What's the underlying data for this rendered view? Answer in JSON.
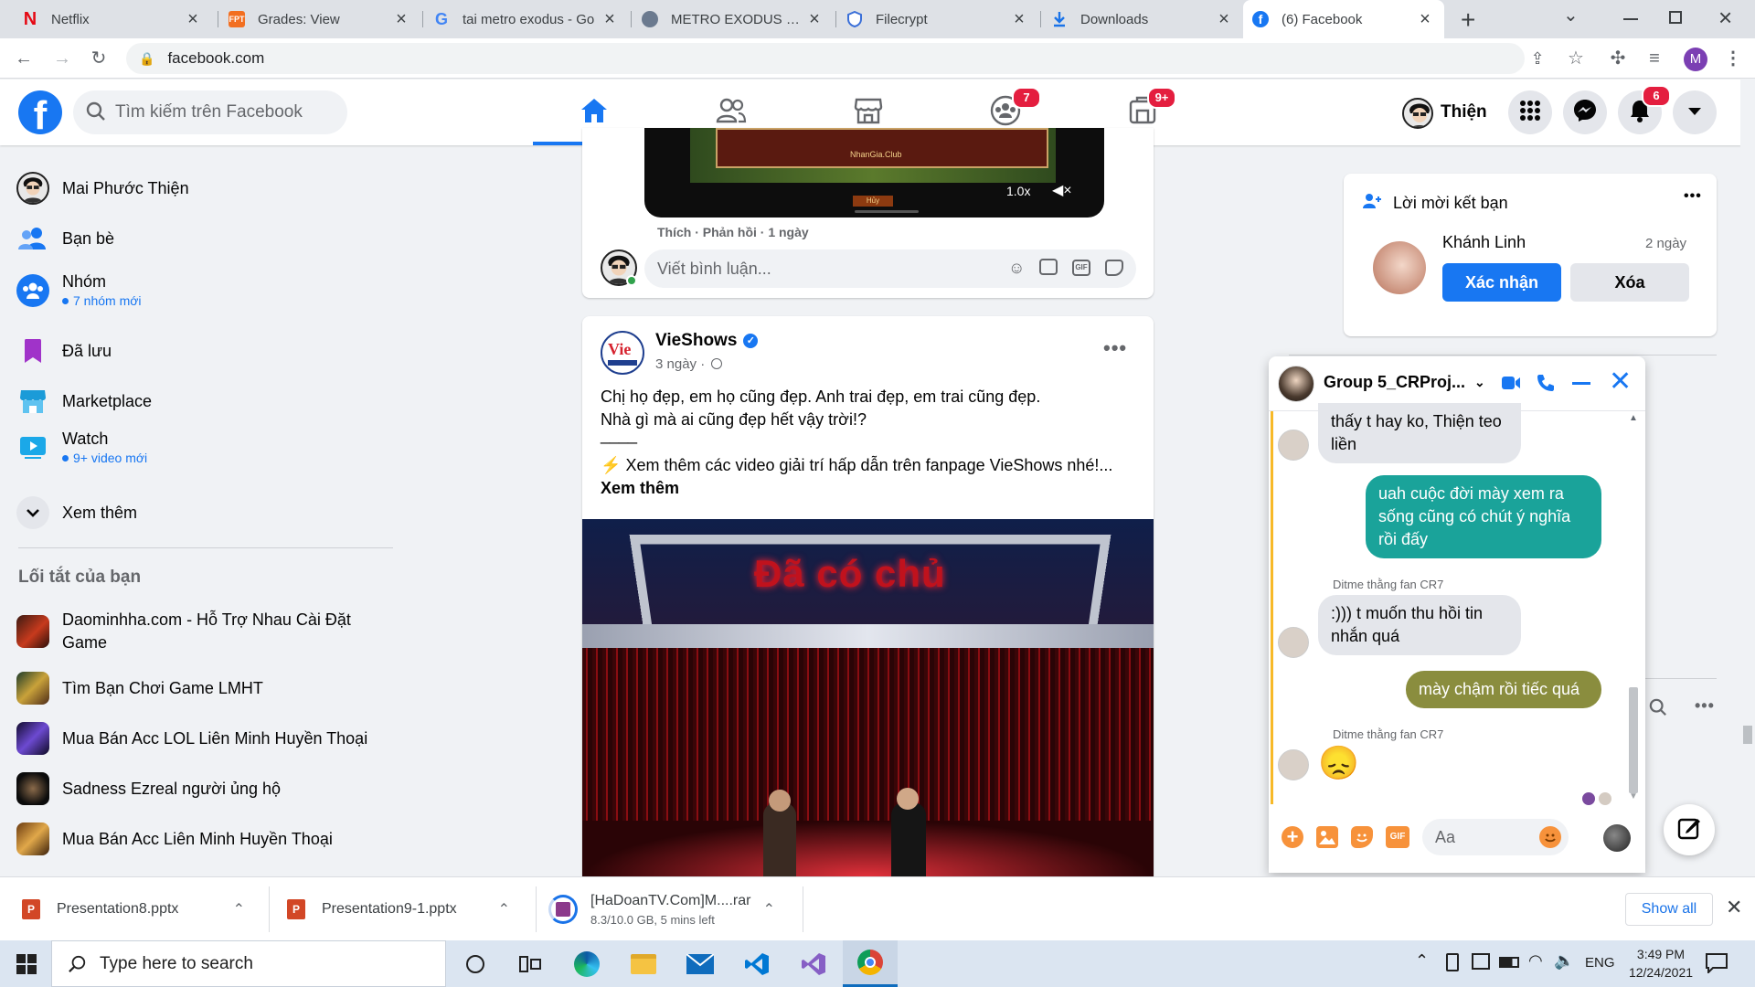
{
  "browser": {
    "tabs": [
      {
        "title": "Netflix",
        "icon": "netflix-icon",
        "color": "#e50914"
      },
      {
        "title": "Grades: View",
        "icon": "fpt-icon",
        "color": "#f26f21"
      },
      {
        "title": "tai metro exodus - Go",
        "icon": "google-icon",
        "color": "#4285f4"
      },
      {
        "title": "METRO EXODUS ENH",
        "icon": "globe-icon",
        "color": "#5f6368"
      },
      {
        "title": "Filecrypt",
        "icon": "shield-icon",
        "color": "#3a6fd8"
      },
      {
        "title": "Downloads",
        "icon": "download-icon",
        "color": "#1a73e8"
      },
      {
        "title": "(6) Facebook",
        "icon": "facebook-icon",
        "color": "#1877f2"
      }
    ],
    "url": "facebook.com",
    "profile_initial": "M"
  },
  "facebook": {
    "search_placeholder": "Tìm kiếm trên Facebook",
    "nav_badges": {
      "groups": "7",
      "gaming": "9+"
    },
    "user_name": "Thiện",
    "notification_count": "6",
    "colors": {
      "brand": "#1877f2",
      "badge": "#e41e3f"
    }
  },
  "sidebar": {
    "items": [
      {
        "label": "Mai Phước Thiện",
        "icon": "avatar"
      },
      {
        "label": "Bạn bè",
        "icon": "friends-icon"
      },
      {
        "label": "Nhóm",
        "sub": "7 nhóm mới",
        "icon": "groups-icon"
      },
      {
        "label": "Đã lưu",
        "icon": "bookmark-icon"
      },
      {
        "label": "Marketplace",
        "icon": "marketplace-icon"
      },
      {
        "label": "Watch",
        "sub": "9+ video mới",
        "icon": "watch-icon"
      },
      {
        "label": "Xem thêm",
        "icon": "chevron-down-icon"
      }
    ],
    "shortcuts_title": "Lối tắt của bạn",
    "shortcuts": [
      "Daominhha.com - Hỗ Trợ Nhau Cài Đặt Game",
      "Tìm Bạn Chơi Game LMHT",
      "Mua Bán Acc LOL Liên Minh Huyền Thoại",
      "Sadness Ezreal người ủng hộ",
      "Mua Bán Acc Liên Minh Huyền Thoại"
    ]
  },
  "feed": {
    "prev_post": {
      "video_speed": "1.0x",
      "video_caption": "NhanGia.Club",
      "video_button": "Hủy",
      "comment_meta": "Thích · Phản hồi · 1 ngày",
      "comment_placeholder": "Viết bình luận..."
    },
    "post": {
      "page_name": "VieShows",
      "time": "3 ngày ·",
      "line1": "Chị họ đẹp, em họ cũng đẹp. Anh trai đẹp, em trai cũng đẹp.",
      "line2": "Nhà gì mà ai cũng đẹp hết vậy trời!?",
      "divider": "____",
      "line3": "Xem thêm các video giải trí hấp dẫn trên fanpage VieShows nhé!...",
      "see_more": "Xem thêm",
      "video_overlay_text": "Đã có chủ"
    }
  },
  "friend_requests": {
    "title": "Lời mời kết bạn",
    "name": "Khánh Linh",
    "time": "2 ngày",
    "confirm": "Xác nhận",
    "delete": "Xóa"
  },
  "chat": {
    "title": "Group 5_CRProj...",
    "messages": [
      {
        "dir": "in",
        "text": "thấy t hay ko, Thiện teo liền"
      },
      {
        "dir": "out",
        "text": "uah cuộc đời mày xem ra sống cũng có chút ý nghĩa rồi đấy",
        "color": "#1aa39a"
      },
      {
        "dir": "in",
        "sender": "Ditme thằng fan CR7",
        "text": ":))) t muốn thu hồi tin nhắn quá"
      },
      {
        "dir": "out",
        "text": "mày chậm rồi tiếc quá",
        "color": "#8a8d3e"
      },
      {
        "dir": "in",
        "sender": "Ditme thằng fan CR7",
        "text": "😞"
      }
    ],
    "input_placeholder": "Aa"
  },
  "downloads": {
    "items": [
      {
        "name": "Presentation8.pptx"
      },
      {
        "name": "Presentation9-1.pptx"
      },
      {
        "name": "[HaDoanTV.Com]M....rar",
        "status": "8.3/10.0 GB, 5 mins left"
      }
    ],
    "show_all": "Show all"
  },
  "taskbar": {
    "search_placeholder": "Type here to search",
    "lang": "ENG",
    "time": "3:49 PM",
    "date": "12/24/2021"
  }
}
